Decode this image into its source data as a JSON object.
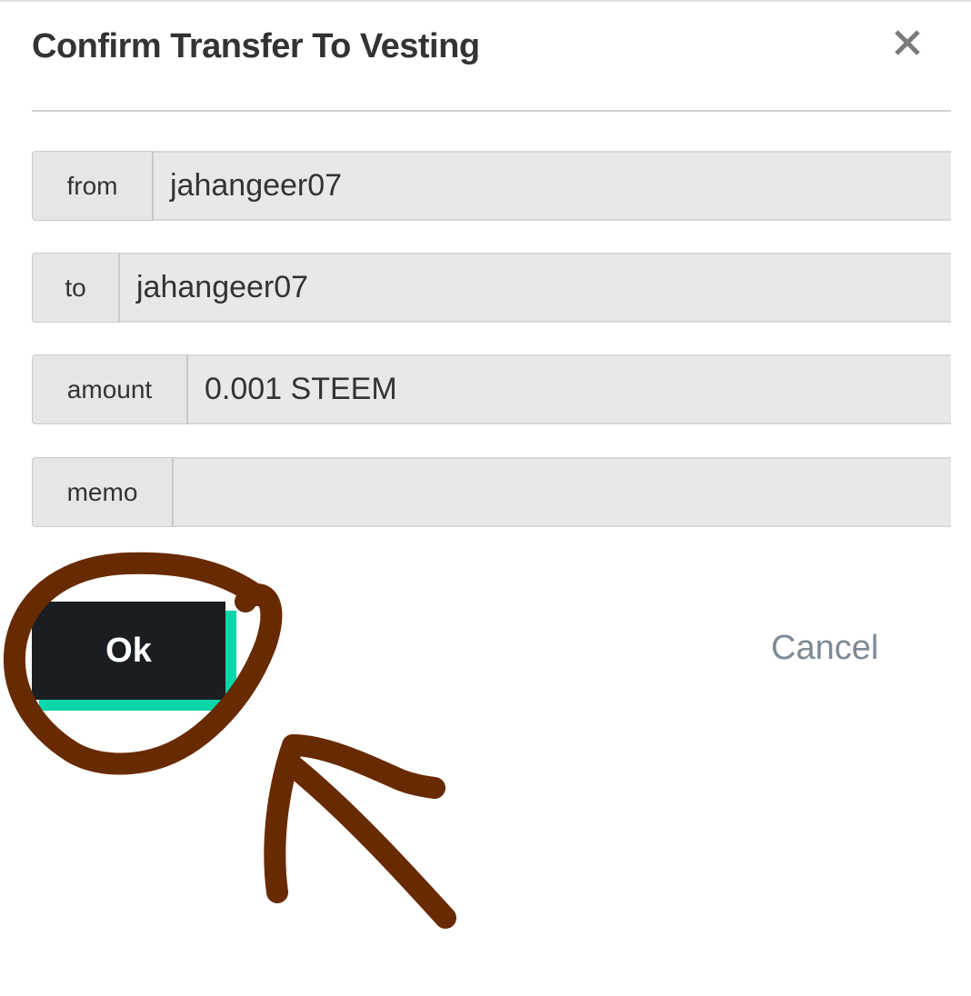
{
  "dialog": {
    "title": "Confirm Transfer To Vesting"
  },
  "fields": [
    {
      "label": "from",
      "value": "jahangeer07"
    },
    {
      "label": "to",
      "value": "jahangeer07"
    },
    {
      "label": "amount",
      "value": "0.001 STEEM"
    },
    {
      "label": "memo",
      "value": ""
    }
  ],
  "actions": {
    "ok_label": "Ok",
    "cancel_label": "Cancel"
  },
  "icons": {
    "close": "close-icon"
  },
  "colors": {
    "ok_background": "#1a1e22",
    "ok_accent": "#06d6a9",
    "cancel_text": "#7d8a96",
    "annotation": "#682a00"
  }
}
